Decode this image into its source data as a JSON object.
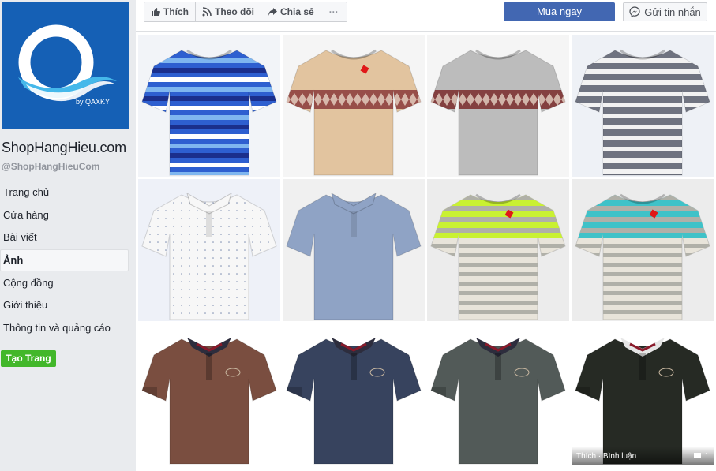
{
  "page": {
    "name": "ShopHangHieu.com",
    "handle": "@ShopHangHieuCom",
    "logo_text": "by QAXKY"
  },
  "nav": [
    {
      "label": "Trang chủ"
    },
    {
      "label": "Cửa hàng"
    },
    {
      "label": "Bài viết"
    },
    {
      "label": "Ảnh",
      "active": true
    },
    {
      "label": "Cộng đồng"
    },
    {
      "label": "Giới thiệu"
    },
    {
      "label": "Thông tin và quảng cáo"
    }
  ],
  "create_page_label": "Tạo Trang",
  "toolbar": {
    "like_label": "Thích",
    "follow_label": "Theo dõi",
    "share_label": "Chia sẻ",
    "more_label": "···",
    "buy_label": "Mua ngay",
    "message_label": "Gửi tin nhắn"
  },
  "overlay": {
    "actions": "Thích · Bình luận",
    "comment_count": "1"
  },
  "colors": {
    "brand_blue": "#4267b2",
    "green": "#42b72a",
    "logo_bg": "#1a5fb4"
  }
}
